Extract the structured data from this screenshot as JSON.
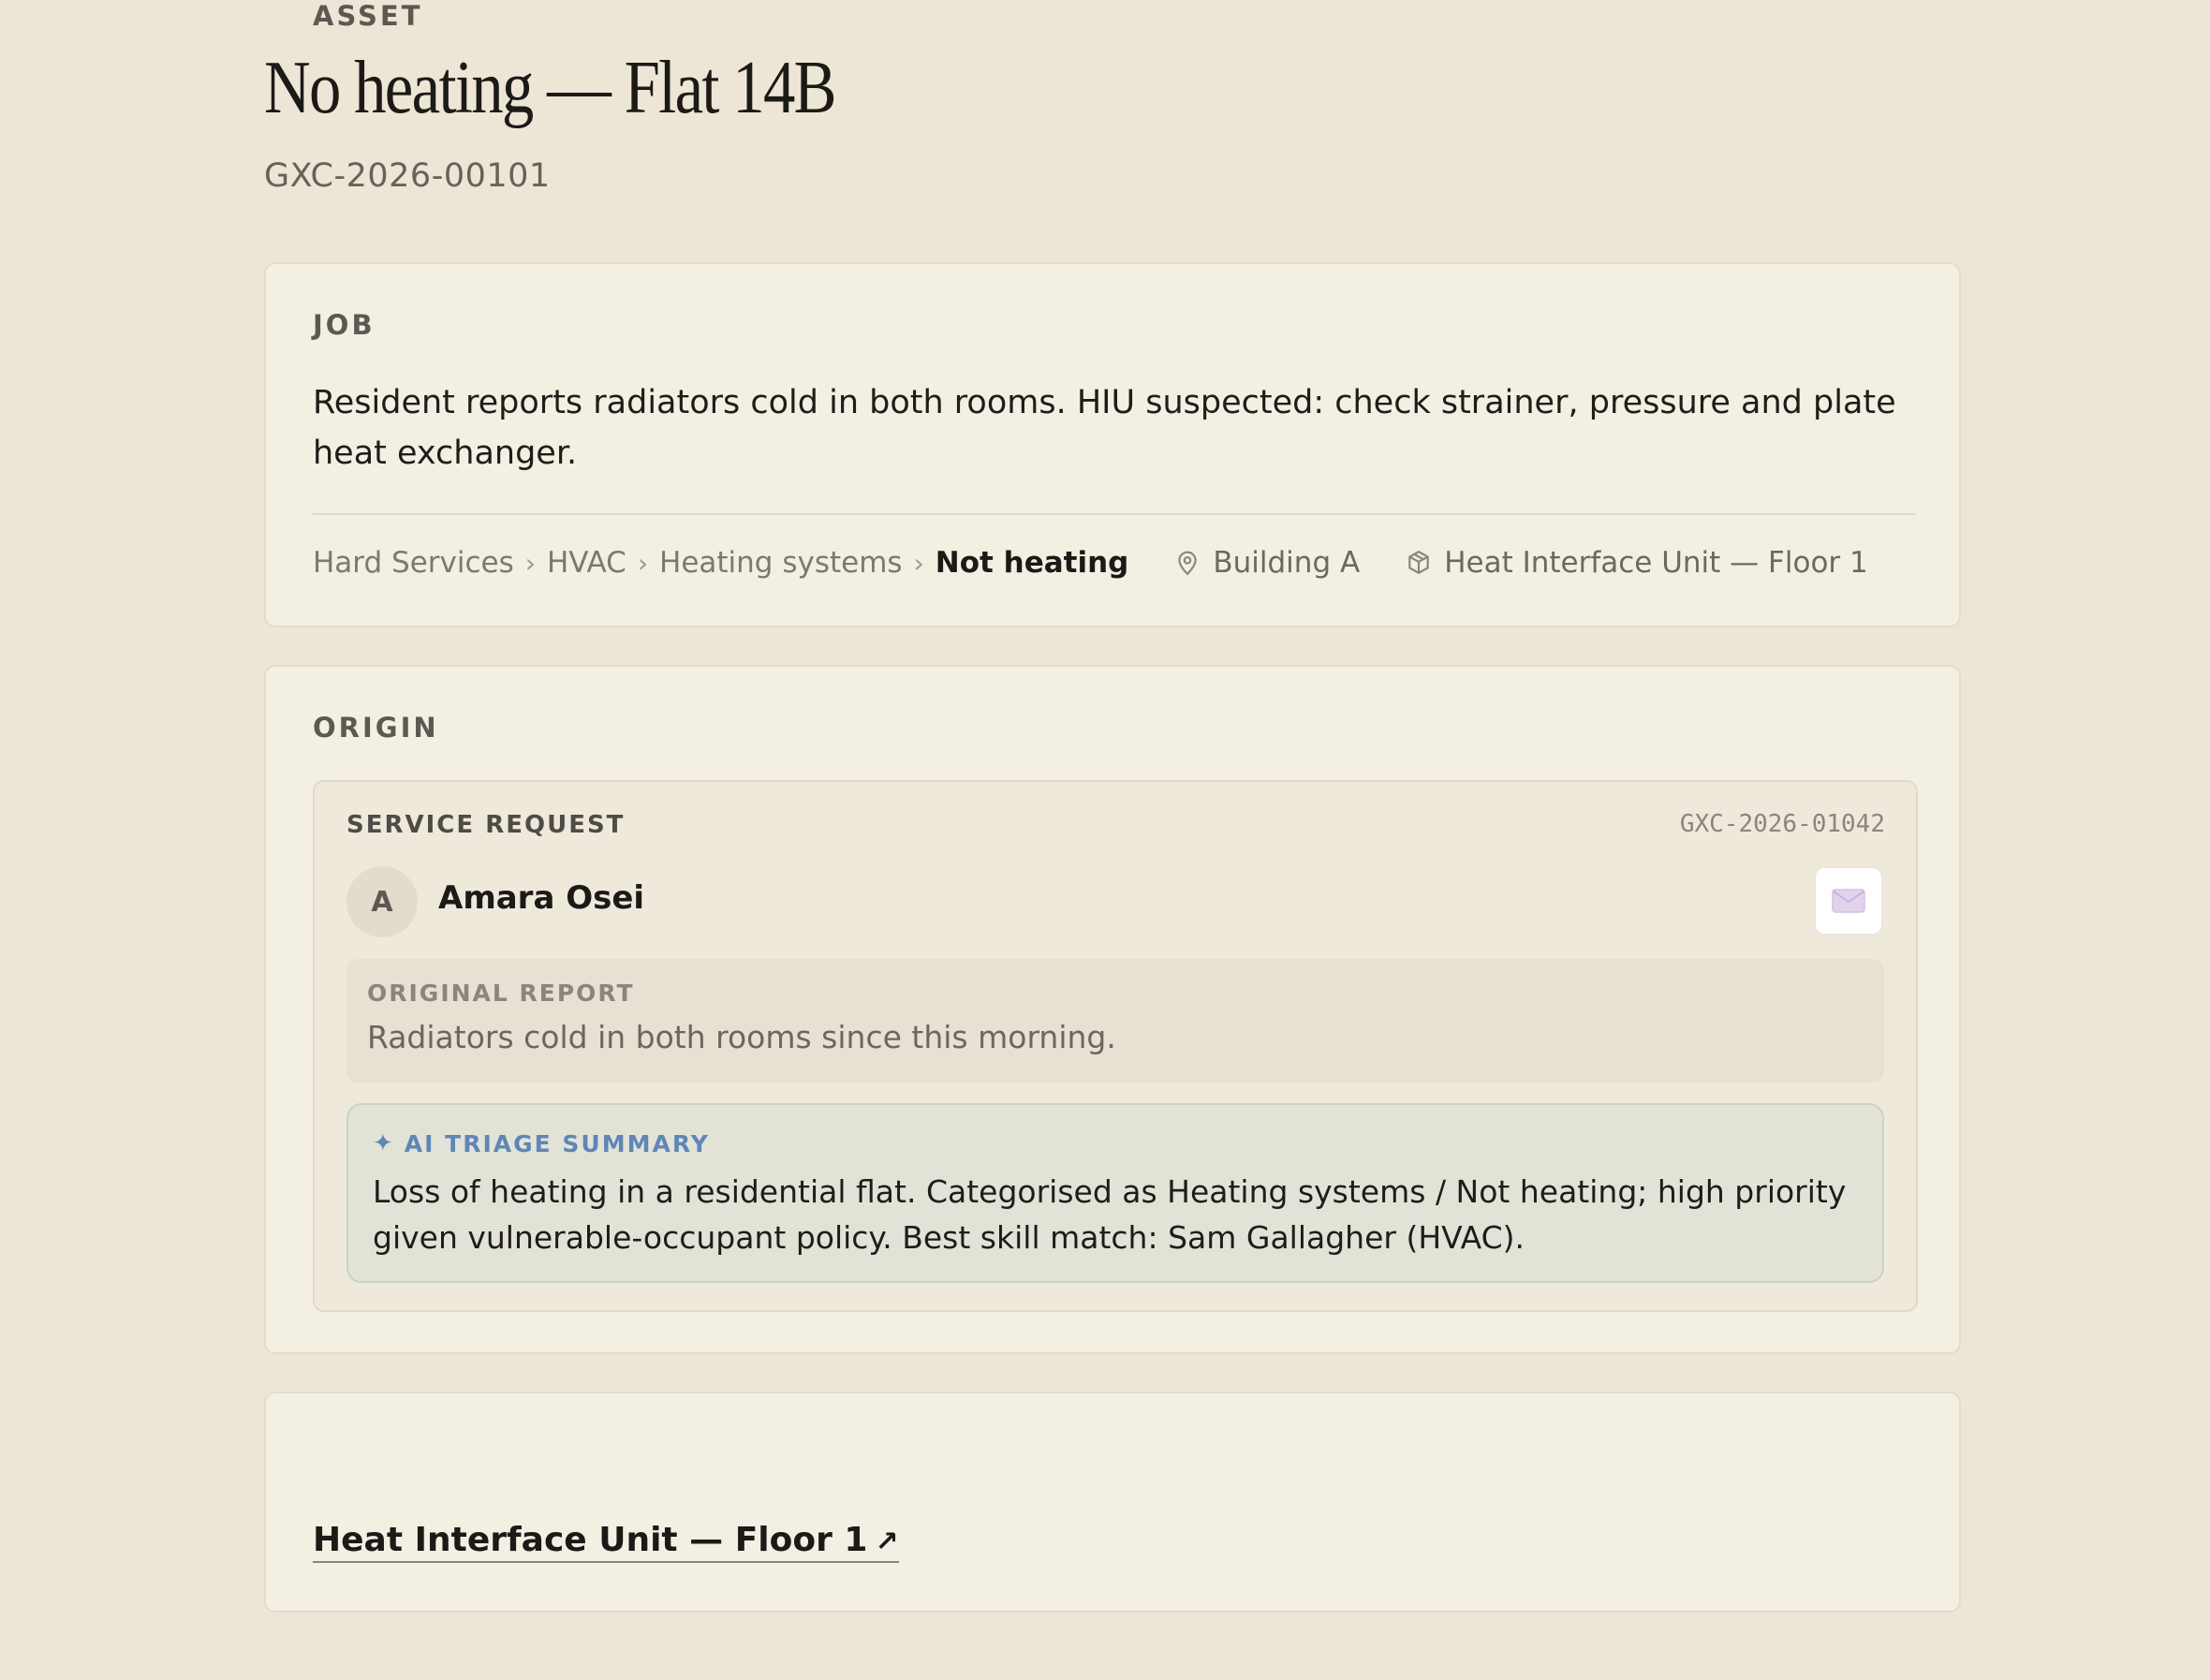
{
  "header": {
    "title": "No heating — Flat 14B",
    "reference": "GXC-2026-00101"
  },
  "job": {
    "section_label": "JOB",
    "description": "Resident reports radiators cold in both rooms. HIU suspected: check strainer, pressure and plate heat exchanger.",
    "breadcrumb": [
      "Hard Services",
      "HVAC",
      "Heating systems",
      "Not heating"
    ],
    "breadcrumb_separator": "›",
    "location_icon": "map-pin-icon",
    "location": "Building A",
    "asset_icon": "box-icon",
    "asset": "Heat Interface Unit — Floor 1"
  },
  "origin": {
    "section_label": "ORIGIN",
    "service_request": {
      "label": "SERVICE REQUEST",
      "reference": "GXC-2026-01042",
      "requester_initial": "A",
      "requester_name": "Amara Osei",
      "channel_icon": "envelope-icon"
    },
    "original_report": {
      "label": "ORIGINAL REPORT",
      "text": "Radiators cold in both rooms since this morning."
    },
    "ai_triage": {
      "icon": "✦",
      "label": "AI TRIAGE SUMMARY",
      "text": "Loss of heating in a residential flat. Categorised as Heating systems / Not heating; high priority given vulnerable-occupant policy. Best skill match: Sam Gallagher (HVAC)."
    }
  },
  "asset_section": {
    "section_label": "ASSET",
    "link_text": "Heat Interface Unit — Floor 1",
    "link_arrow": "↗"
  },
  "colors": {
    "page_background": "#ede6d6",
    "card_background": "#f3efe2",
    "ai_accent": "#5f86b5",
    "envelope": "#d9c8e6"
  }
}
